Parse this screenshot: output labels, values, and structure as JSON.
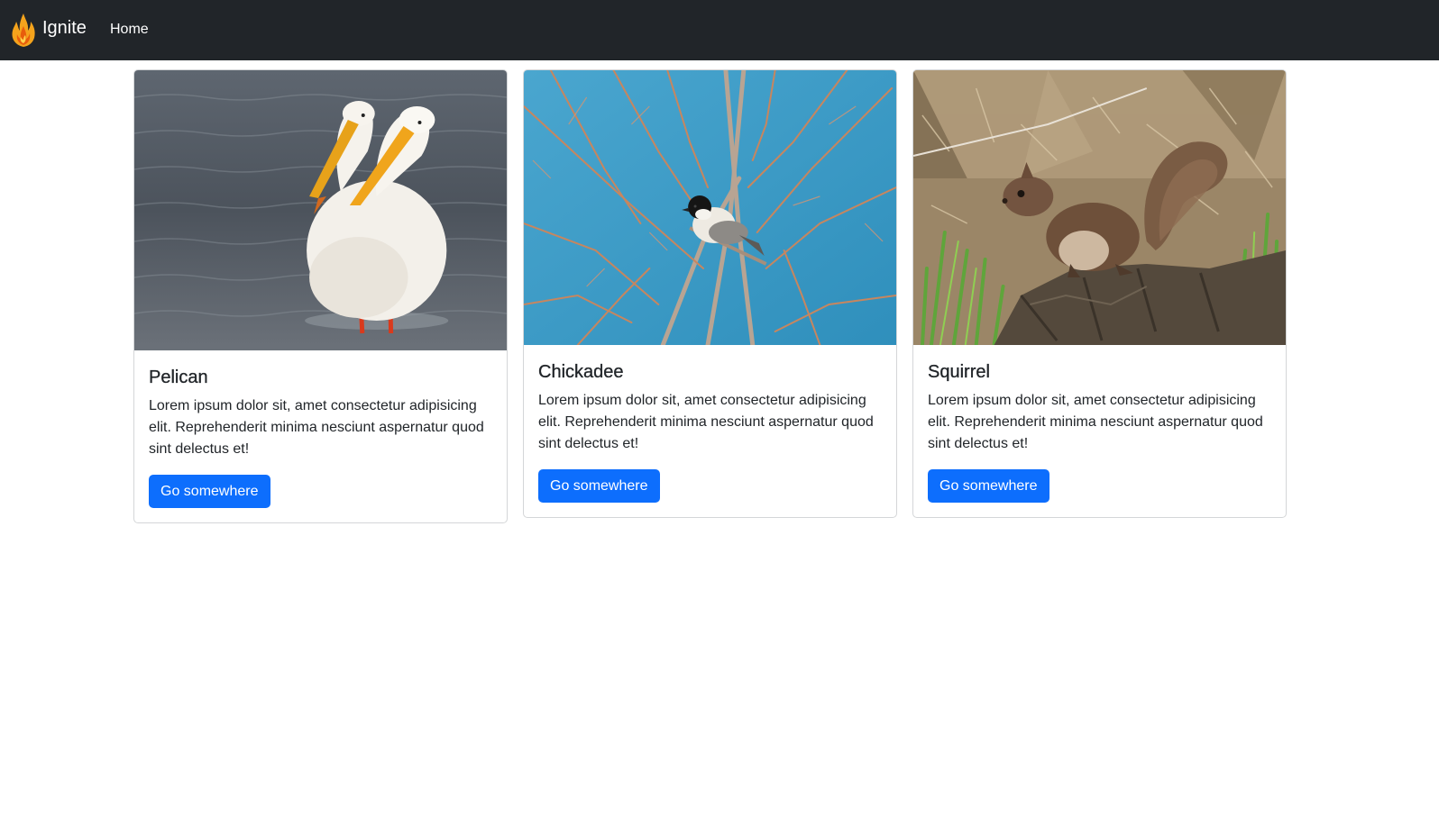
{
  "navbar": {
    "brand": "Ignite",
    "links": [
      "Home"
    ]
  },
  "cards": [
    {
      "title": "Pelican",
      "text": "Lorem ipsum dolor sit, amet consectetur adipisicing elit. Reprehenderit minima nesciunt aspernatur quod sint delectus et!",
      "button": "Go somewhere",
      "image": "pelicans-in-water"
    },
    {
      "title": "Chickadee",
      "text": "Lorem ipsum dolor sit, amet consectetur adipisicing elit. Reprehenderit minima nesciunt aspernatur quod sint delectus et!",
      "button": "Go somewhere",
      "image": "chickadee-on-branches"
    },
    {
      "title": "Squirrel",
      "text": "Lorem ipsum dolor sit, amet consectetur adipisicing elit. Reprehenderit minima nesciunt aspernatur quod sint delectus et!",
      "button": "Go somewhere",
      "image": "squirrel-on-log"
    }
  ],
  "colors": {
    "navbar": "#212529",
    "button": "#0d6efd"
  }
}
